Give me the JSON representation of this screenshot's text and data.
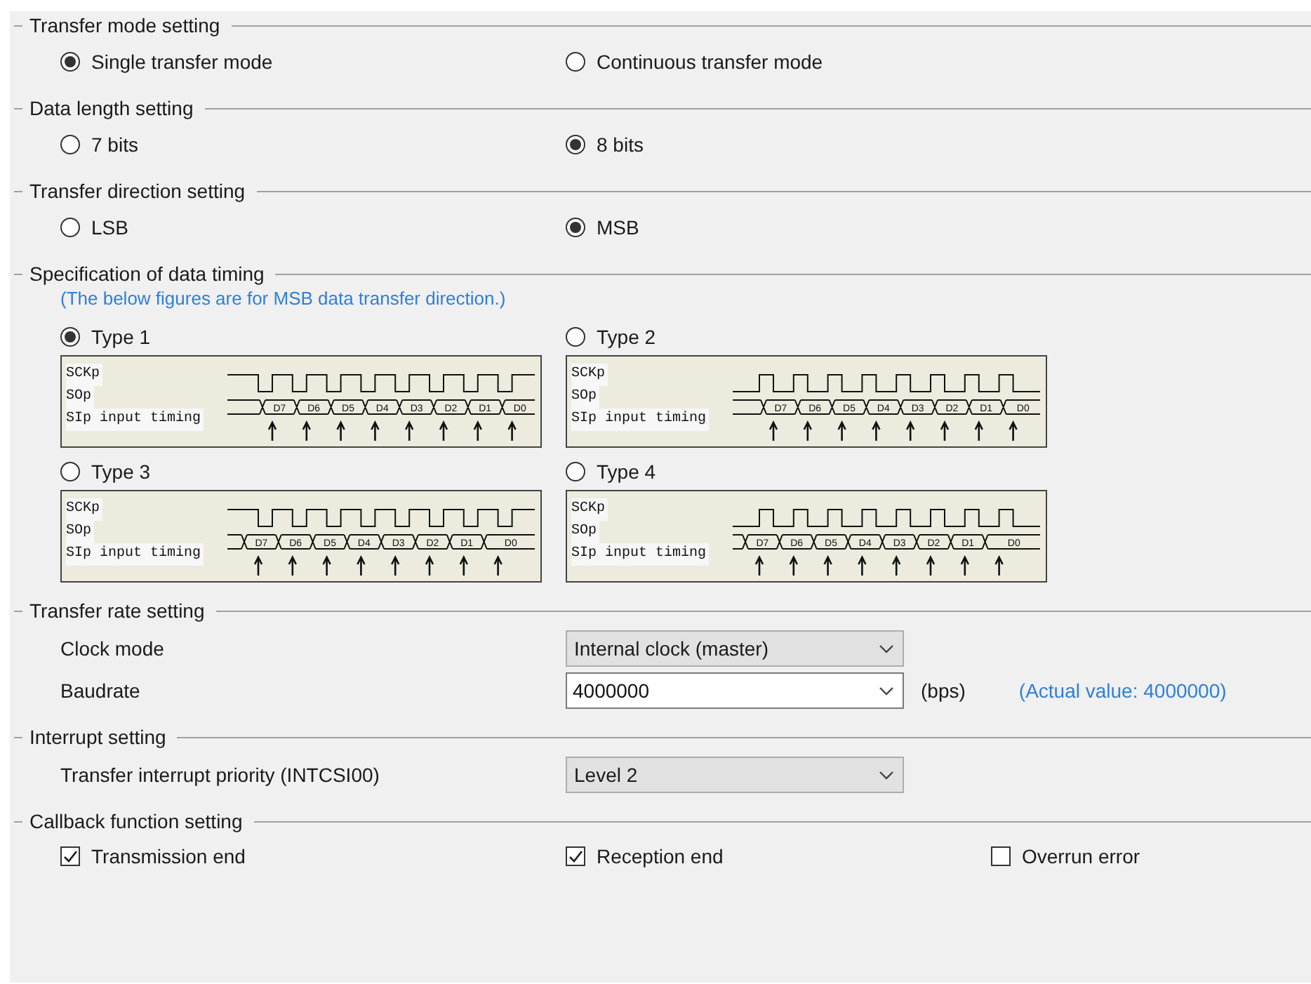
{
  "sections": [
    {
      "title": "Transfer mode setting",
      "kind": "radios",
      "options": [
        {
          "label": "Single transfer mode",
          "selected": true
        },
        {
          "label": "Continuous transfer mode",
          "selected": false
        }
      ]
    },
    {
      "title": "Data length setting",
      "kind": "radios",
      "options": [
        {
          "label": "7 bits",
          "selected": false
        },
        {
          "label": "8 bits",
          "selected": true
        }
      ]
    },
    {
      "title": "Transfer direction setting",
      "kind": "radios",
      "options": [
        {
          "label": "LSB",
          "selected": false
        },
        {
          "label": "MSB",
          "selected": true
        }
      ]
    },
    {
      "title": "Specification of data timing",
      "kind": "timing",
      "note": "(The below figures are for MSB data transfer direction.)",
      "options": [
        {
          "label": "Type 1",
          "selected": true,
          "diagram": {
            "clock_idle_high": true,
            "early_data": false,
            "signals": [
              "SCKp",
              "SOp",
              "SIp input timing"
            ],
            "bits": [
              "D7",
              "D6",
              "D5",
              "D4",
              "D3",
              "D2",
              "D1",
              "D0"
            ]
          }
        },
        {
          "label": "Type 2",
          "selected": false,
          "diagram": {
            "clock_idle_high": false,
            "early_data": false,
            "signals": [
              "SCKp",
              "SOp",
              "SIp input timing"
            ],
            "bits": [
              "D7",
              "D6",
              "D5",
              "D4",
              "D3",
              "D2",
              "D1",
              "D0"
            ]
          }
        },
        {
          "label": "Type 3",
          "selected": false,
          "diagram": {
            "clock_idle_high": true,
            "early_data": true,
            "signals": [
              "SCKp",
              "SOp",
              "SIp input timing"
            ],
            "bits": [
              "D7",
              "D6",
              "D5",
              "D4",
              "D3",
              "D2",
              "D1",
              "D0"
            ]
          }
        },
        {
          "label": "Type 4",
          "selected": false,
          "diagram": {
            "clock_idle_high": false,
            "early_data": true,
            "signals": [
              "SCKp",
              "SOp",
              "SIp input timing"
            ],
            "bits": [
              "D7",
              "D6",
              "D5",
              "D4",
              "D3",
              "D2",
              "D1",
              "D0"
            ]
          }
        }
      ]
    },
    {
      "title": "Transfer rate setting",
      "kind": "fields",
      "fields": [
        {
          "label": "Clock mode",
          "kind": "select",
          "value": "Internal clock (master)"
        },
        {
          "label": "Baudrate",
          "kind": "combo",
          "value": "4000000",
          "unit": "(bps)",
          "note": "(Actual value: 4000000)"
        }
      ]
    },
    {
      "title": "Interrupt setting",
      "kind": "fields",
      "fields": [
        {
          "label": "Transfer interrupt priority (INTCSI00)",
          "kind": "select",
          "value": "Level 2"
        }
      ]
    },
    {
      "title": "Callback function setting",
      "kind": "checks",
      "options": [
        {
          "label": "Transmission end",
          "checked": true
        },
        {
          "label": "Reception end",
          "checked": true
        },
        {
          "label": "Overrun error",
          "checked": false
        }
      ]
    }
  ]
}
